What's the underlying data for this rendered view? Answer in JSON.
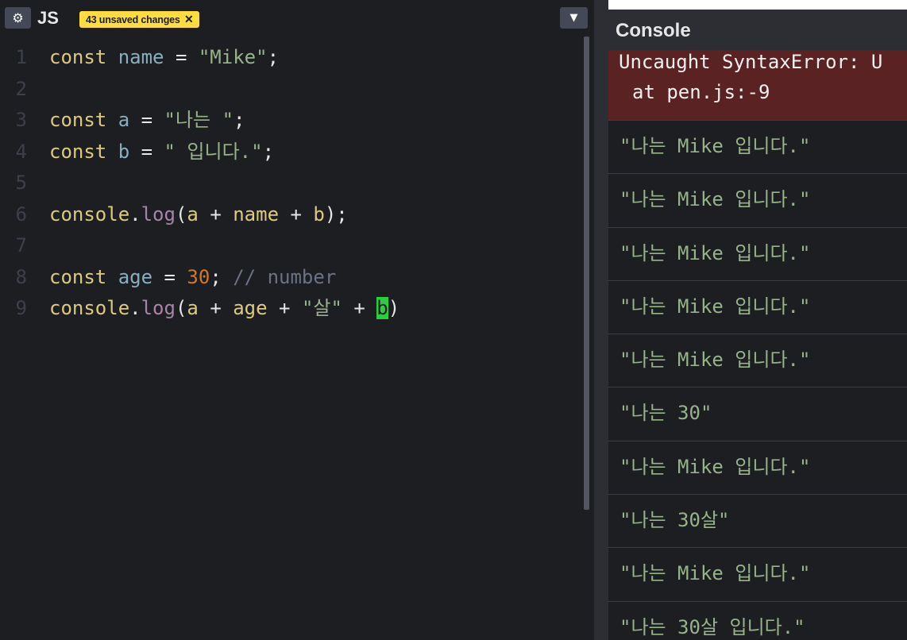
{
  "editor": {
    "settings_icon": "gear-icon",
    "language": "JS",
    "unsaved_badge": "43 unsaved changes",
    "badge_close": "✕",
    "collapse_icon": "chevron-down-icon",
    "lines": [
      {
        "num": "1",
        "tokens": [
          [
            "kw",
            "const "
          ],
          [
            "var",
            "name"
          ],
          [
            "pun",
            " = "
          ],
          [
            "str",
            "\"Mike\""
          ],
          [
            "pun",
            ";"
          ]
        ]
      },
      {
        "num": "2",
        "tokens": []
      },
      {
        "num": "3",
        "tokens": [
          [
            "kw",
            "const "
          ],
          [
            "var",
            "a"
          ],
          [
            "pun",
            " = "
          ],
          [
            "str",
            "\"나는 \""
          ],
          [
            "pun",
            ";"
          ]
        ]
      },
      {
        "num": "4",
        "tokens": [
          [
            "kw",
            "const "
          ],
          [
            "var",
            "b"
          ],
          [
            "pun",
            " = "
          ],
          [
            "str",
            "\" 입니다.\""
          ],
          [
            "pun",
            ";"
          ]
        ]
      },
      {
        "num": "5",
        "tokens": []
      },
      {
        "num": "6",
        "tokens": [
          [
            "fn",
            "console"
          ],
          [
            "pun",
            "."
          ],
          [
            "prop",
            "log"
          ],
          [
            "pun",
            "("
          ],
          [
            "fn",
            "a"
          ],
          [
            "pun",
            " + "
          ],
          [
            "fn",
            "name"
          ],
          [
            "pun",
            " + "
          ],
          [
            "fn",
            "b"
          ],
          [
            "pun",
            ");"
          ]
        ]
      },
      {
        "num": "7",
        "tokens": []
      },
      {
        "num": "8",
        "tokens": [
          [
            "kw",
            "const "
          ],
          [
            "var",
            "age"
          ],
          [
            "pun",
            " = "
          ],
          [
            "num",
            "30"
          ],
          [
            "pun",
            "; "
          ],
          [
            "cmt",
            "// number"
          ]
        ]
      },
      {
        "num": "9",
        "tokens": [
          [
            "fn",
            "console"
          ],
          [
            "pun",
            "."
          ],
          [
            "prop",
            "log"
          ],
          [
            "pun",
            "("
          ],
          [
            "fn",
            "a"
          ],
          [
            "pun",
            " + "
          ],
          [
            "fn",
            "age"
          ],
          [
            "pun",
            " + "
          ],
          [
            "str",
            "\"살\""
          ],
          [
            "pun",
            " + "
          ],
          [
            "cursor",
            "b"
          ],
          [
            "pun",
            ")"
          ]
        ]
      }
    ]
  },
  "console": {
    "title": "Console",
    "error_line1": "Uncaught SyntaxError: U",
    "error_line2": "at pen.js:-9",
    "logs": [
      "\"나는 Mike 입니다.\"",
      "\"나는 Mike 입니다.\"",
      "\"나는 Mike 입니다.\"",
      "\"나는 Mike 입니다.\"",
      "\"나는 Mike 입니다.\"",
      "\"나는 30\"",
      "\"나는 Mike 입니다.\"",
      "\"나는 30살\"",
      "\"나는 Mike 입니다.\"",
      "\"나는 30살 입니다.\""
    ]
  }
}
